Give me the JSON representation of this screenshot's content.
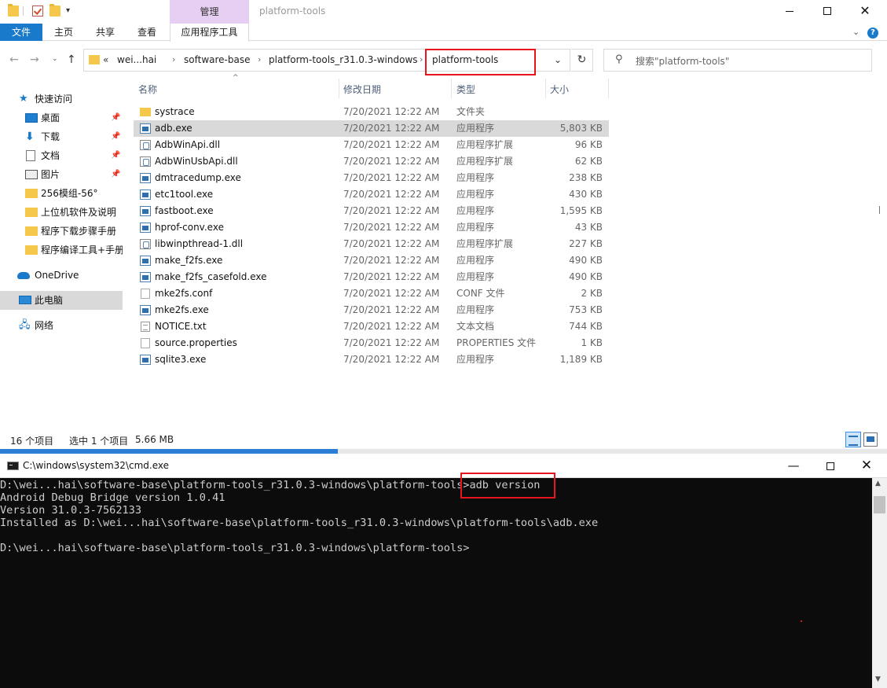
{
  "explorer": {
    "window_title": "platform-tools",
    "context_tab_header": "管理",
    "ribbon_tabs": [
      "文件",
      "主页",
      "共享",
      "查看",
      "应用程序工具"
    ],
    "breadcrumbs": {
      "overflow": "«",
      "items": [
        "wei...hai",
        "software-base",
        "platform-tools_r31.0.3-windows",
        "platform-tools"
      ]
    },
    "search_placeholder": "搜索\"platform-tools\"",
    "nav_pane": {
      "quick_access": "快速访问",
      "items": [
        {
          "label": "桌面",
          "icon": "desktop-icon",
          "pinned": true
        },
        {
          "label": "下载",
          "icon": "download-icon",
          "pinned": true
        },
        {
          "label": "文档",
          "icon": "document-icon",
          "pinned": true
        },
        {
          "label": "图片",
          "icon": "pictures-icon",
          "pinned": true
        },
        {
          "label": "256模组-56°",
          "icon": "folder-icon",
          "pinned": false
        },
        {
          "label": "上位机软件及说明",
          "icon": "folder-icon",
          "pinned": false
        },
        {
          "label": "程序下载步骤手册",
          "icon": "folder-icon",
          "pinned": false
        },
        {
          "label": "程序编译工具+手册",
          "icon": "folder-icon",
          "pinned": false
        }
      ],
      "onedrive": "OneDrive",
      "this_pc": "此电脑",
      "network": "网络"
    },
    "columns": {
      "name": "名称",
      "date": "修改日期",
      "type": "类型",
      "size": "大小"
    },
    "files": [
      {
        "name": "systrace",
        "date": "7/20/2021 12:22 AM",
        "type": "文件夹",
        "size": "",
        "icon": "folder",
        "selected": false
      },
      {
        "name": "adb.exe",
        "date": "7/20/2021 12:22 AM",
        "type": "应用程序",
        "size": "5,803 KB",
        "icon": "exe",
        "selected": true
      },
      {
        "name": "AdbWinApi.dll",
        "date": "7/20/2021 12:22 AM",
        "type": "应用程序扩展",
        "size": "96 KB",
        "icon": "dll",
        "selected": false
      },
      {
        "name": "AdbWinUsbApi.dll",
        "date": "7/20/2021 12:22 AM",
        "type": "应用程序扩展",
        "size": "62 KB",
        "icon": "dll",
        "selected": false
      },
      {
        "name": "dmtracedump.exe",
        "date": "7/20/2021 12:22 AM",
        "type": "应用程序",
        "size": "238 KB",
        "icon": "exe",
        "selected": false
      },
      {
        "name": "etc1tool.exe",
        "date": "7/20/2021 12:22 AM",
        "type": "应用程序",
        "size": "430 KB",
        "icon": "exe",
        "selected": false
      },
      {
        "name": "fastboot.exe",
        "date": "7/20/2021 12:22 AM",
        "type": "应用程序",
        "size": "1,595 KB",
        "icon": "exe",
        "selected": false
      },
      {
        "name": "hprof-conv.exe",
        "date": "7/20/2021 12:22 AM",
        "type": "应用程序",
        "size": "43 KB",
        "icon": "exe",
        "selected": false
      },
      {
        "name": "libwinpthread-1.dll",
        "date": "7/20/2021 12:22 AM",
        "type": "应用程序扩展",
        "size": "227 KB",
        "icon": "dll",
        "selected": false
      },
      {
        "name": "make_f2fs.exe",
        "date": "7/20/2021 12:22 AM",
        "type": "应用程序",
        "size": "490 KB",
        "icon": "exe",
        "selected": false
      },
      {
        "name": "make_f2fs_casefold.exe",
        "date": "7/20/2021 12:22 AM",
        "type": "应用程序",
        "size": "490 KB",
        "icon": "exe",
        "selected": false
      },
      {
        "name": "mke2fs.conf",
        "date": "7/20/2021 12:22 AM",
        "type": "CONF 文件",
        "size": "2 KB",
        "icon": "blank",
        "selected": false
      },
      {
        "name": "mke2fs.exe",
        "date": "7/20/2021 12:22 AM",
        "type": "应用程序",
        "size": "753 KB",
        "icon": "exe",
        "selected": false
      },
      {
        "name": "NOTICE.txt",
        "date": "7/20/2021 12:22 AM",
        "type": "文本文档",
        "size": "744 KB",
        "icon": "txt",
        "selected": false
      },
      {
        "name": "source.properties",
        "date": "7/20/2021 12:22 AM",
        "type": "PROPERTIES 文件",
        "size": "1 KB",
        "icon": "blank",
        "selected": false
      },
      {
        "name": "sqlite3.exe",
        "date": "7/20/2021 12:22 AM",
        "type": "应用程序",
        "size": "1,189 KB",
        "icon": "exe",
        "selected": false
      }
    ],
    "status": {
      "count": "16 个项目",
      "selection": "选中 1 个项目",
      "size": "5.66 MB"
    }
  },
  "cmd": {
    "title": "C:\\windows\\system32\\cmd.exe",
    "lines": [
      "D:\\wei...hai\\software-base\\platform-tools_r31.0.3-windows\\platform-tools>adb version",
      "Android Debug Bridge version 1.0.41",
      "Version 31.0.3-7562133",
      "Installed as D:\\wei...hai\\software-base\\platform-tools_r31.0.3-windows\\platform-tools\\adb.exe",
      "",
      "D:\\wei...hai\\software-base\\platform-tools_r31.0.3-windows\\platform-tools>"
    ]
  },
  "colors": {
    "accent": "#1979ca",
    "context_tab": "#e6cff2",
    "selection": "#d9d9d9",
    "highlight_box": "#e8141e",
    "console_bg": "#0c0c0c",
    "console_fg": "#cccccc"
  }
}
